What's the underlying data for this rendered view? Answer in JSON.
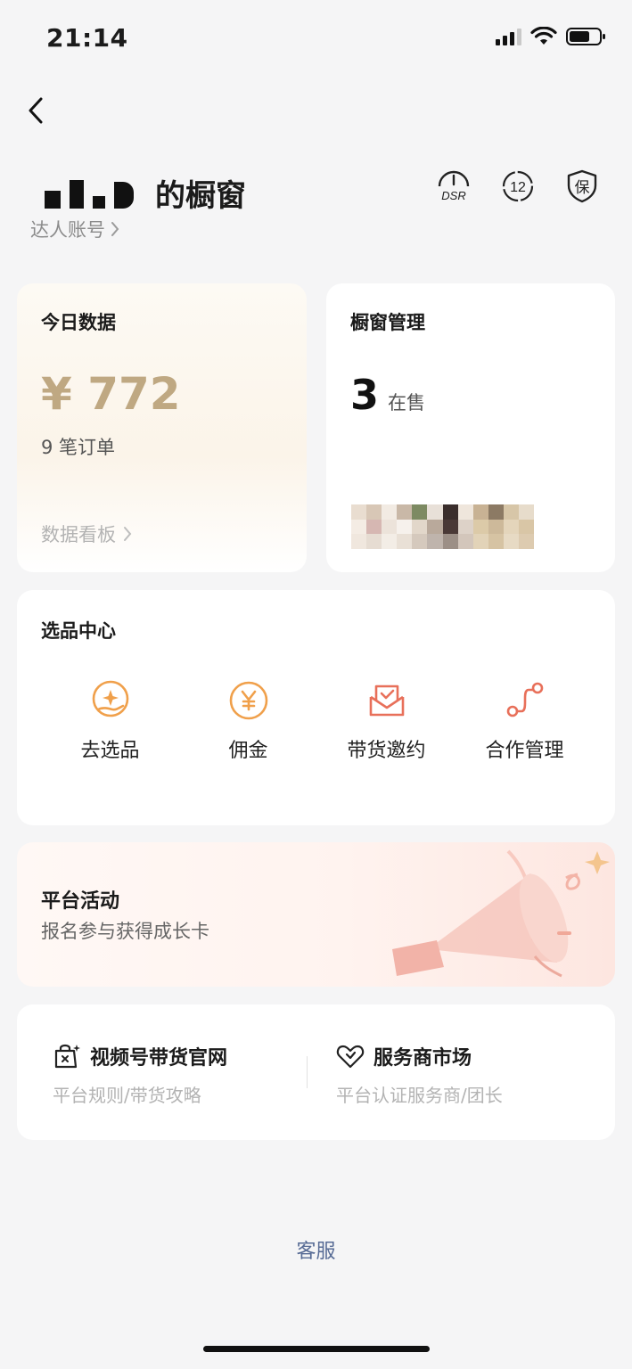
{
  "status_bar": {
    "time": "21:14"
  },
  "header": {
    "shop_title": "的橱窗",
    "account_link": "达人账号",
    "icons": [
      "dsr-icon",
      "twelve-badge-icon",
      "guarantee-icon"
    ],
    "dsr_text": "DSR",
    "twelve_text": "12",
    "guarantee_text": "保"
  },
  "today": {
    "title": "今日数据",
    "amount": "¥ 772",
    "orders": "9 笔订单",
    "dashboard_link": "数据看板"
  },
  "window_mgmt": {
    "title": "橱窗管理",
    "count": "3",
    "count_unit": "在售"
  },
  "selection_center": {
    "title": "选品中心",
    "items": [
      {
        "label": "去选品",
        "icon": "select-products-icon"
      },
      {
        "label": "佣金",
        "icon": "commission-icon"
      },
      {
        "label": "带货邀约",
        "icon": "invitation-icon"
      },
      {
        "label": "合作管理",
        "icon": "cooperation-icon"
      }
    ]
  },
  "activity": {
    "title": "平台活动",
    "subtitle": "报名参与获得成长卡"
  },
  "links": [
    {
      "title": "视频号带货官网",
      "subtitle": "平台规则/带货攻略",
      "icon": "shopping-bag-icon"
    },
    {
      "title": "服务商市场",
      "subtitle": "平台认证服务商/团长",
      "icon": "handshake-heart-icon"
    }
  ],
  "support": "客服",
  "colors": {
    "gold": "#bfa882",
    "accent_orange": "#f0a04b",
    "accent_red": "#e8705a",
    "link_blue": "#576b95"
  }
}
